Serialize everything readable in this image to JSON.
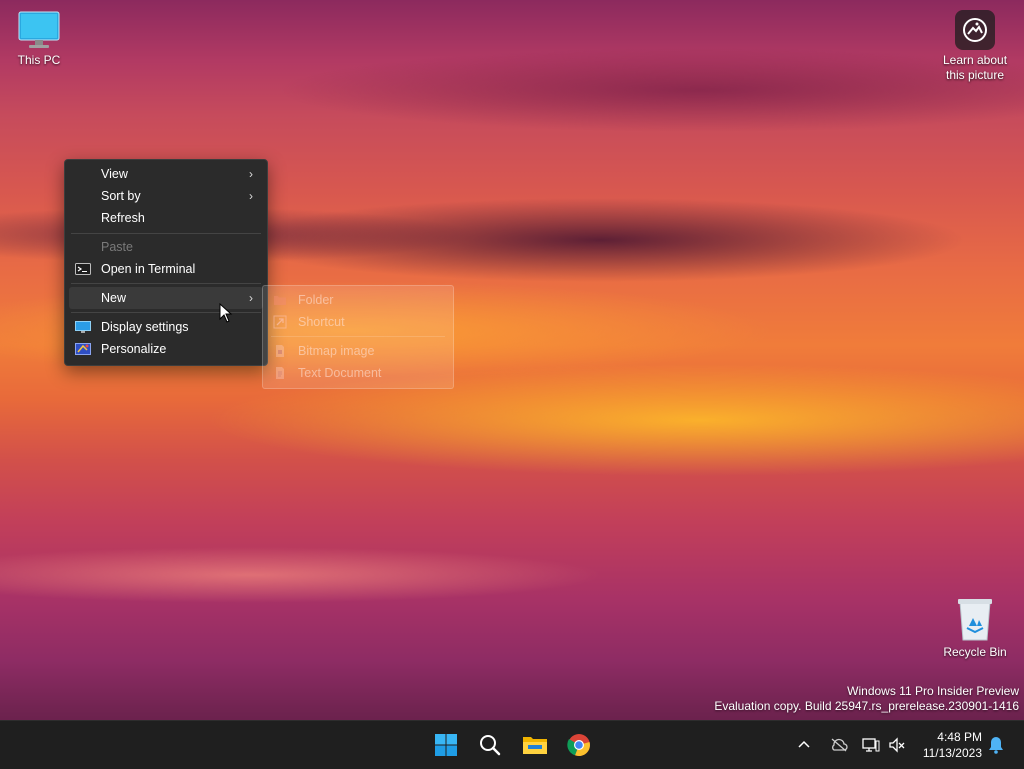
{
  "desktop": {
    "this_pc": "This PC",
    "learn_about": "Learn about\nthis picture",
    "recycle_bin": "Recycle Bin"
  },
  "context_menu": {
    "view": "View",
    "sort_by": "Sort by",
    "refresh": "Refresh",
    "paste": "Paste",
    "open_terminal": "Open in Terminal",
    "new": "New",
    "display_settings": "Display settings",
    "personalize": "Personalize"
  },
  "submenu": {
    "folder": "Folder",
    "shortcut": "Shortcut",
    "bitmap": "Bitmap image",
    "text_doc": "Text Document"
  },
  "watermark": {
    "line1": "Windows 11 Pro Insider Preview",
    "line2": "Evaluation copy. Build 25947.rs_prerelease.230901-1416"
  },
  "taskbar": {
    "time": "4:48 PM",
    "date": "11/13/2023"
  },
  "icons": {
    "start": "windows-logo-icon",
    "search": "search-icon",
    "explorer": "folder-icon",
    "chrome": "chrome-icon",
    "tray_chevron": "chevron-up-icon",
    "onedrive": "cloud-off-icon",
    "network": "network-icon",
    "volume": "volume-muted-icon",
    "notifications": "bell-icon"
  },
  "colors": {
    "menu_bg": "#2b2b2b",
    "taskbar_bg": "#1f1f1f",
    "accent": "#0078d4"
  }
}
